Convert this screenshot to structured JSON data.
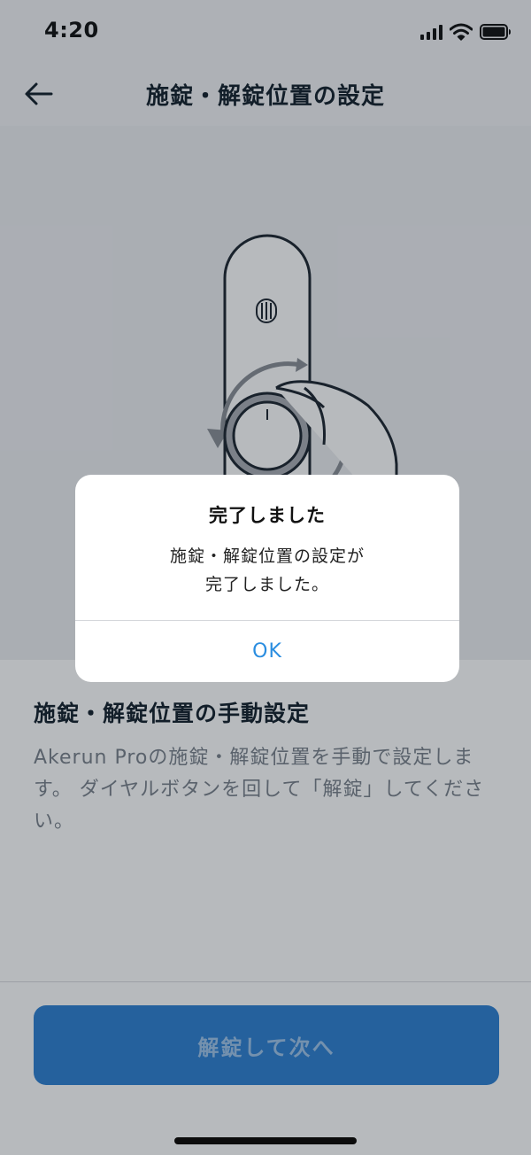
{
  "status_bar": {
    "time": "4:20"
  },
  "nav": {
    "title": "施錠・解錠位置の設定"
  },
  "content": {
    "heading": "施錠・解錠位置の手動設定",
    "body": "Akerun Proの施錠・解錠位置を手動で設定します。 ダイヤルボタンを回して「解錠」してください。"
  },
  "footer": {
    "next_button_label": "解錠して次へ"
  },
  "alert": {
    "title": "完了しました",
    "message_line1": "施錠・解錠位置の設定が",
    "message_line2": "完了しました。",
    "ok_label": "OK"
  },
  "icons": {
    "back": "arrow-left-icon",
    "signal": "cellular-signal-icon",
    "wifi": "wifi-icon",
    "battery": "battery-icon"
  },
  "colors": {
    "accent": "#2f80d2",
    "alert_button": "#2a8de0",
    "title_text": "#14202b",
    "body_text": "#7a828b"
  }
}
